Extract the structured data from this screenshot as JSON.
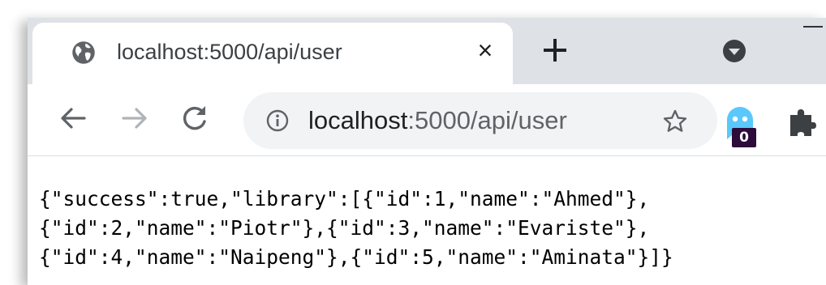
{
  "tab": {
    "title": "localhost:5000/api/user",
    "close_label": "×"
  },
  "omnibox": {
    "host": "localhost",
    "path": ":5000/api/user"
  },
  "extensions": {
    "ghost_badge": "0"
  },
  "body_lines": [
    "{\"success\":true,\"library\":[{\"id\":1,\"name\":\"Ahmed\"},",
    "{\"id\":2,\"name\":\"Piotr\"},{\"id\":3,\"name\":\"Evariste\"},",
    "{\"id\":4,\"name\":\"Naipeng\"},{\"id\":5,\"name\":\"Aminata\"}]}"
  ],
  "colors": {
    "tabstrip": "#dee1e6",
    "omnibox": "#f1f3f4",
    "badge": "#2d0b3a",
    "ghost": "#5ac8fa"
  }
}
